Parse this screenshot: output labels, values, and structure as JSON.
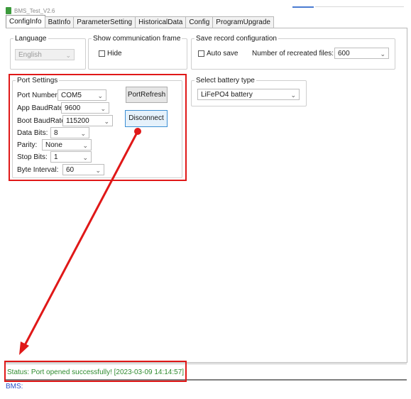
{
  "window": {
    "title": "BMS_Test_V2.6"
  },
  "tabs": [
    "ConfigInfo",
    "BatInfo",
    "ParameterSetting",
    "HistoricalData",
    "Config",
    "ProgramUpgrade"
  ],
  "language": {
    "legend": "Language",
    "value": "English"
  },
  "comm": {
    "legend": "Show communication frame",
    "hide_label": "Hide"
  },
  "save": {
    "legend": "Save record configuration",
    "auto_label": "Auto save",
    "files_label": "Number of recreated files:",
    "files_value": "600"
  },
  "port": {
    "legend": "Port Settings",
    "port_number": {
      "label": "Port Number:",
      "value": "COM5"
    },
    "app_baud": {
      "label": "App BaudRate:",
      "value": "9600"
    },
    "boot_baud": {
      "label": "Boot BaudRate:",
      "value": "115200"
    },
    "data_bits": {
      "label": "Data Bits:",
      "value": "8"
    },
    "parity": {
      "label": "Parity:",
      "value": "None"
    },
    "stop_bits": {
      "label": "Stop Bits:",
      "value": "1"
    },
    "byte_interval": {
      "label": "Byte Interval:",
      "value": "60"
    },
    "refresh_label": "PortRefresh",
    "disconnect_label": "Disconnect"
  },
  "battery": {
    "legend": "Select battery type",
    "value": "LiFePO4 battery"
  },
  "status": {
    "text": "Status: Port opened successfully! [2023-03-09 14:14:57]"
  },
  "bms": {
    "text": "BMS:"
  },
  "colors": {
    "highlight": "#e01818",
    "status_text": "#2e8b2e",
    "focus_border": "#3c8fd4"
  }
}
